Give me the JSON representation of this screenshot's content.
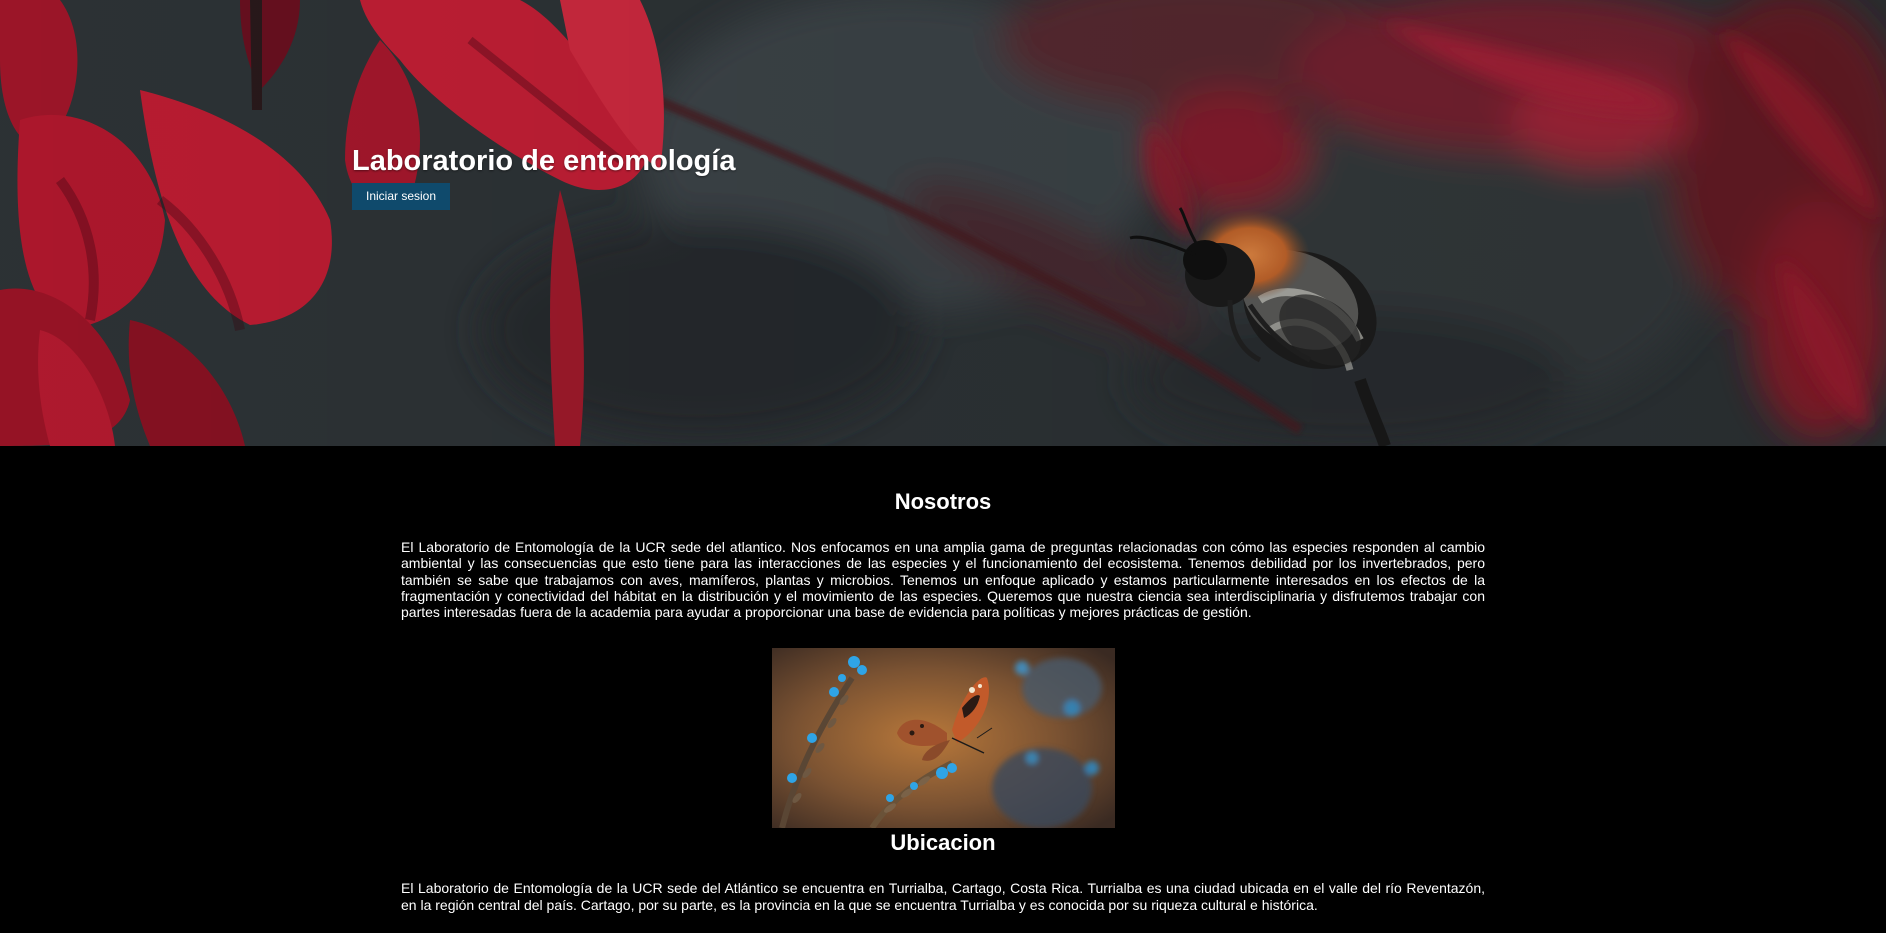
{
  "hero": {
    "title": "Laboratorio de entomología",
    "login_label": "Iniciar sesion",
    "background_image": "hero-bee-red-flowers"
  },
  "about": {
    "title": "Nosotros",
    "text": "El Laboratorio de Entomología de la UCR sede del atlantico. Nos enfocamos en una amplia gama de preguntas relacionadas con cómo las especies responden al cambio ambiental y las consecuencias que esto tiene para las interacciones de las especies y el funcionamiento del ecosistema. Tenemos debilidad por los invertebrados, pero también se sabe que trabajamos con aves, mamíferos, plantas y microbios. Tenemos un enfoque aplicado y estamos particularmente interesados en los efectos de la fragmentación y conectividad del hábitat en la distribución y el movimiento de las especies. Queremos que nuestra ciencia sea interdisciplinaria y disfrutemos trabajar con partes interesadas fuera de la academia para ayudar a proporcionar una base de evidencia para políticas y mejores prácticas de gestión.",
    "image": "butterfly-on-blue-flowers"
  },
  "location": {
    "title": "Ubicacion",
    "text": "El Laboratorio de Entomología de la UCR sede del Atlántico se encuentra en Turrialba, Cartago, Costa Rica. Turrialba es una ciudad ubicada en el valle del río Reventazón, en la región central del país. Cartago, por su parte, es la provincia en la que se encuentra Turrialba y es conocida por su riqueza cultural e histórica."
  },
  "colors": {
    "page_background": "#000000",
    "button_background": "#0f4a6c",
    "text": "#ffffff"
  }
}
